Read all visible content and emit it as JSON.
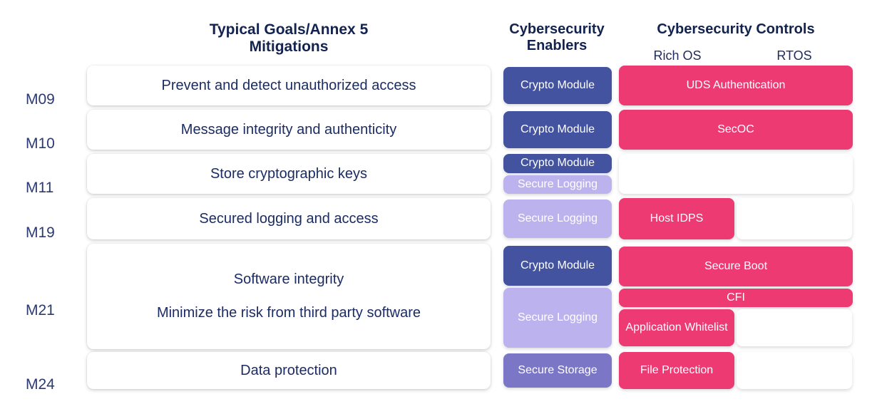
{
  "headers": {
    "mitigations_line1": "Typical Goals/Annex 5",
    "mitigations_line2": "Mitigations",
    "enablers_line1": "Cybersecurity",
    "enablers_line2": "Enablers",
    "controls": "Cybersecurity Controls",
    "controls_sub_left": "Rich OS",
    "controls_sub_right": "RTOS"
  },
  "colors": {
    "crypto_module": "#43539F",
    "secure_logging": "#BCB3EE",
    "secure_storage": "#7B77C6",
    "control_pink": "#ED3A72",
    "text_navy": "#1B2C63",
    "card_white": "#FFFFFF"
  },
  "rows": [
    {
      "code": "M09",
      "mitigation_lines": [
        "Prevent and detect unauthorized access"
      ],
      "enablers": [
        {
          "label": "Crypto Module",
          "kind": "crypto"
        }
      ],
      "controls": [
        {
          "label": "UDS Authentication",
          "span": "full",
          "kind": "pink"
        }
      ]
    },
    {
      "code": "M10",
      "mitigation_lines": [
        "Message integrity and authenticity"
      ],
      "enablers": [
        {
          "label": "Crypto Module",
          "kind": "crypto"
        }
      ],
      "controls": [
        {
          "label": "SecOC",
          "span": "full",
          "kind": "pink"
        }
      ]
    },
    {
      "code": "M11",
      "mitigation_lines": [
        "Store cryptographic keys"
      ],
      "enablers": [
        {
          "label": "Crypto Module",
          "kind": "crypto"
        },
        {
          "label": "Secure Logging",
          "kind": "logging"
        }
      ],
      "controls": [
        {
          "label": "",
          "span": "full",
          "kind": "empty"
        }
      ]
    },
    {
      "code": "M19",
      "mitigation_lines": [
        "Secured logging and access"
      ],
      "enablers": [
        {
          "label": "Secure Logging",
          "kind": "logging"
        }
      ],
      "controls": [
        {
          "label": "Host IDPS",
          "span": "half",
          "kind": "pink"
        },
        {
          "label": "",
          "span": "half",
          "kind": "empty"
        }
      ]
    },
    {
      "code": "M21",
      "mitigation_lines": [
        "Software integrity",
        "Minimize the risk from third party software"
      ],
      "enablers": [
        {
          "label": "Crypto Module",
          "kind": "crypto"
        },
        {
          "label": "Secure Logging",
          "kind": "logging"
        }
      ],
      "controls": [
        {
          "label": "Secure Boot",
          "span": "full",
          "kind": "pink"
        },
        {
          "label": "CFI",
          "span": "full",
          "kind": "pink"
        },
        {
          "label": "Application Whitelist",
          "span": "half",
          "kind": "pink"
        },
        {
          "label": "",
          "span": "half",
          "kind": "empty"
        }
      ]
    },
    {
      "code": "M24",
      "mitigation_lines": [
        "Data protection"
      ],
      "enablers": [
        {
          "label": "Secure Storage",
          "kind": "storage"
        }
      ],
      "controls": [
        {
          "label": "File Protection",
          "span": "half",
          "kind": "pink"
        },
        {
          "label": "",
          "span": "half",
          "kind": "empty"
        }
      ]
    }
  ]
}
